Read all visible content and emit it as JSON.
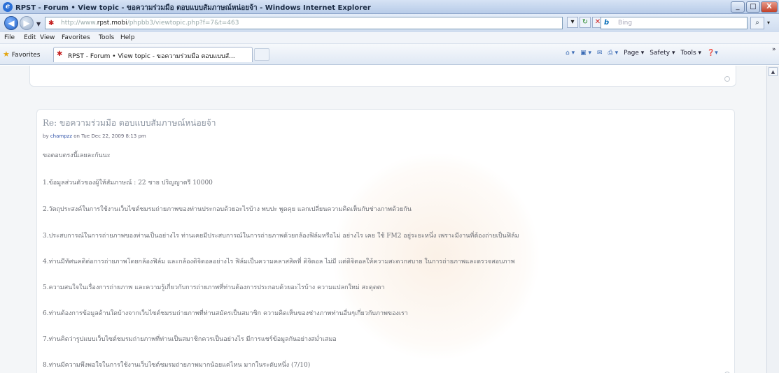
{
  "window": {
    "title": "RPST - Forum • View topic - ขอความร่วมมือ ตอบแบบสัมภาษณ์หน่อยจ้า - Windows Internet Explorer",
    "minimize": "_",
    "maximize": "□",
    "close": "X"
  },
  "address": {
    "url_prefix": "http://www.",
    "url_host": "rpst.mobi",
    "url_rest": "/phpbb3/viewtopic.php?f=7&t=463",
    "search_brand": "b",
    "search_placeholder": "Bing",
    "back": "◀",
    "forward": "▶"
  },
  "menu": {
    "items": [
      "File",
      "Edit",
      "View",
      "Favorites",
      "Tools",
      "Help"
    ]
  },
  "favorites": {
    "label": "Favorites",
    "tab_label": "RPST - Forum • View topic - ขอความร่วมมือ ตอบแบบสั...",
    "commands": [
      "Page ▾",
      "Safety ▾",
      "Tools ▾"
    ]
  },
  "post": {
    "subject": "Re: ขอความร่วมมือ ตอบแบบสัมภาษณ์หน่อยจ้า",
    "byline_prefix": "by",
    "author": "champzz",
    "byline_date": "on Tue Dec 22, 2009 8:13 pm",
    "greeting": "ขอตอบตรงนี้เลยละกันนะ",
    "answers": [
      "1.ข้อมูลส่วนตัวของผู้ให้สัมภาษณ์ : 22 ชาย ปริญญาตรี 10000",
      "2.วัตถุประสงค์ในการใช้งานเว็บไซต์ชมรมถ่ายภาพของท่านประกอบด้วยอะไรบ้าง พบปะ พูดคุย แลกเปลี่ยนความคิดเห็นกับช่างภาพด้วยกัน",
      "3.ประสบการณ์ในการถ่ายภาพของท่านเป็นอย่างไร ท่านเคยมีประสบการณ์ในการถ่ายภาพด้วยกล้องฟิล์มหรือไม่ อย่างไร เคย ใช้ FM2 อยู่ระยะหนึ่ง เพราะมีงานที่ต้องถ่ายเป็นฟิล์ม",
      "4.ท่านมีทัศนคติต่อการถ่ายภาพโดยกล้องฟิล์ม และกล้องดิจิตอลอย่างไร ฟิล์มเป็นความคลาสสิคที่ ดิจิตอล ไม่มี แต่ดิจิตอลให้ความสะดวกสบาย ในการถ่ายภาพและตรวจสอบภาพ",
      "5.ความสนใจในเรื่องการถ่ายภาพ และความรู้เกี่ยวกับการถ่ายภาพที่ท่านต้องการประกอบด้วยอะไรบ้าง ความแปลกใหม่ สะดุดตา",
      "6.ท่านต้องการข้อมูลด้านใดบ้างจากเว็บไซต์ชมรมถ่ายภาพที่ท่านสมัครเป็นสมาชิก ความคิดเห็นของช่างภาพท่านอื่นๆเกี่ยวกับภาพของเรา",
      "7.ท่านคิดว่ารูปแบบเว็บไซต์ชมรมถ่ายภาพที่ท่านเป็นสมาชิกควรเป็นอย่างไร มีการแชร์ข้อมูลกันอย่างสม่ำเสมอ",
      "8.ท่านมีความพึงพอใจในการใช้งานเว็บไซต์ชมรมถ่ายภาพมากน้อยแค่ไหน มากในระดับหนึ่ง (7/10)"
    ]
  },
  "colors": {
    "link": "#3355aa",
    "post_text": "#6c6f76",
    "subject": "#8a93a0",
    "title_gradient_top": "#d6e3f5",
    "title_gradient_bottom": "#b7cbe8"
  }
}
